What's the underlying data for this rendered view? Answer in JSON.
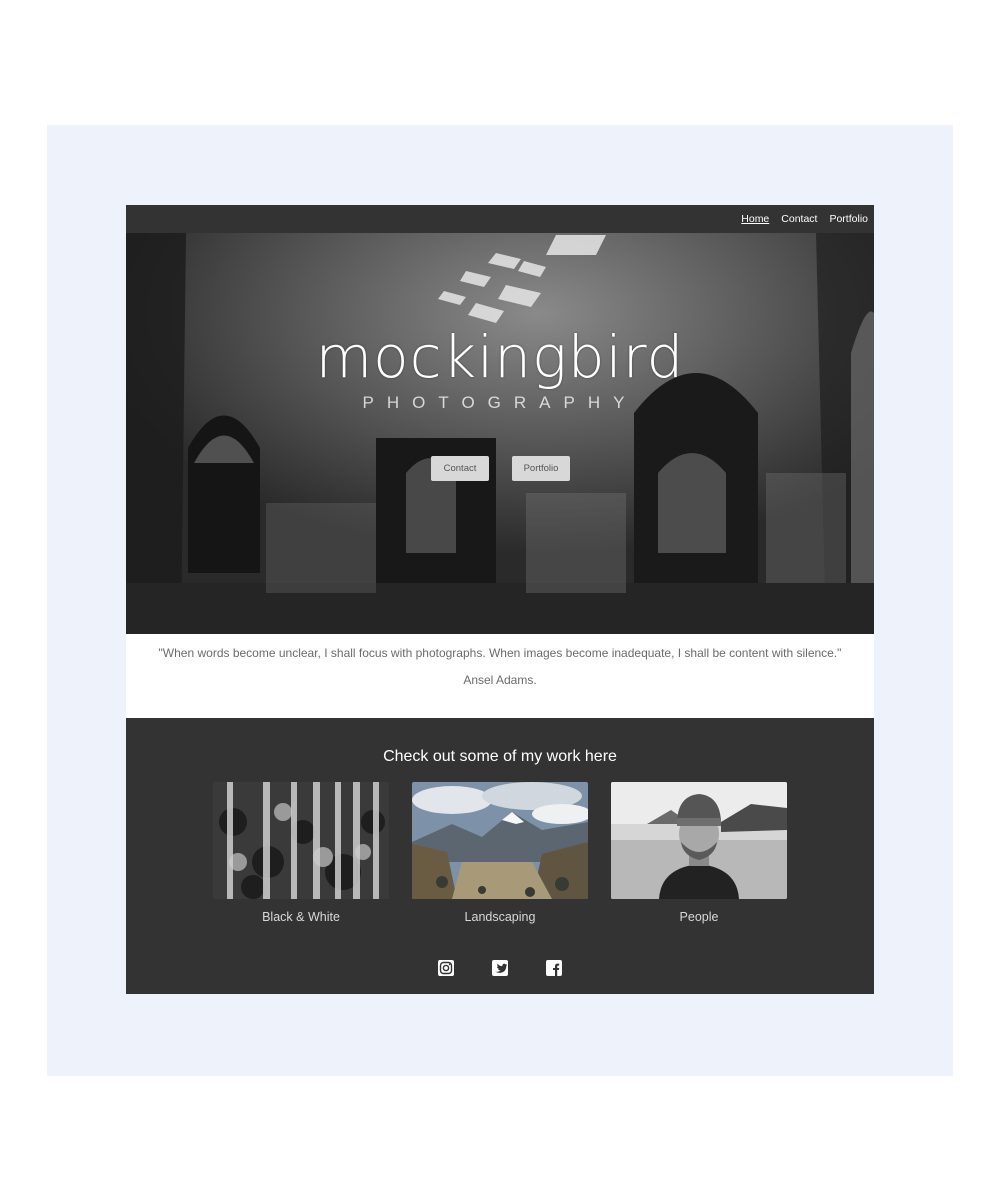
{
  "nav": {
    "items": [
      {
        "label": "Home",
        "active": true
      },
      {
        "label": "Contact",
        "active": false
      },
      {
        "label": "Portfolio",
        "active": false
      }
    ]
  },
  "hero": {
    "brand": "mockingbird",
    "subtitle": "PHOTOGRAPHY",
    "buttons": {
      "contact": "Contact",
      "portfolio": "Portfolio"
    }
  },
  "quote": {
    "text": "\"When words become unclear, I shall focus with photographs. When images become inadequate, I shall be content with silence.\"",
    "author": "Ansel Adams."
  },
  "work": {
    "title": "Check out some of my work here",
    "cards": [
      {
        "caption": "Black & White"
      },
      {
        "caption": "Landscaping"
      },
      {
        "caption": "People"
      }
    ]
  },
  "social": {
    "icons": [
      "instagram-icon",
      "twitter-icon",
      "facebook-icon"
    ]
  },
  "colors": {
    "nav_bg": "#333333",
    "section_bg": "#333333",
    "outer_bg": "#eef3fb",
    "quote_text": "#6b6b6b"
  }
}
